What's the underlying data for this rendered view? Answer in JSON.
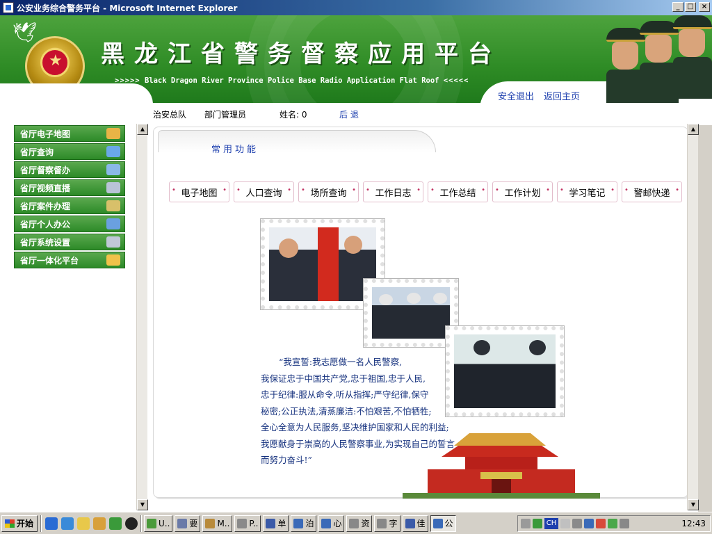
{
  "window": {
    "title": "公安业务综合警务平台 - Microsoft Internet Explorer",
    "buttons": {
      "minimize": "_",
      "maximize": "□",
      "close": "×"
    }
  },
  "header": {
    "title": "黑龙江省警务督察应用平台",
    "subtitle_arrows_left": ">>>>>",
    "subtitle": "Black Dragon River Province Police Base Radio Application Flat Roof",
    "subtitle_arrows_right": "<<<<<",
    "links": {
      "logout": "安全退出",
      "home": "返回主页"
    }
  },
  "info": {
    "unit": "治安总队",
    "role": "部门管理员",
    "name_label": "姓名: 0",
    "logout": "后 退"
  },
  "nav": {
    "items": [
      {
        "label": "省厅电子地图",
        "icon": "hand-map-icon",
        "color": "#e8b446"
      },
      {
        "label": "省厅查询",
        "icon": "magnifier-icon",
        "color": "#6aa8e8"
      },
      {
        "label": "省厅督察督办",
        "icon": "network-icon",
        "color": "#8ab8e8"
      },
      {
        "label": "省厅视频直播",
        "icon": "camera-icon",
        "color": "#b9c3d6"
      },
      {
        "label": "省厅案件办理",
        "icon": "pen-icon",
        "color": "#d8c06a"
      },
      {
        "label": "省厅个人办公",
        "icon": "person-icon",
        "color": "#6aa0e0"
      },
      {
        "label": "省厅系统设置",
        "icon": "settings-icon",
        "color": "#c0c8d8"
      },
      {
        "label": "省厅一体化平台",
        "icon": "grid-icon",
        "color": "#f0c24a"
      }
    ]
  },
  "main": {
    "tab_label": "常用功能",
    "functions": [
      "电子地图",
      "人口查询",
      "场所查询",
      "工作日志",
      "工作总结",
      "工作计划",
      "学习笔记",
      "警邮快递"
    ],
    "oath": [
      "“我宣誓:我志愿做一名人民警察,",
      "我保证忠于中国共产党,忠于祖国,忠于人民,",
      "忠于纪律:服从命令,听从指挥;严守纪律,保守",
      "秘密;公正执法,清蒸廉洁:不怕艰苦,不怕牺牲;",
      "全心全意为人民服务,坚决维护国家和人民的利益;",
      "我愿献身于崇高的人民警察事业,为实现自己的誓言",
      "而努力奋斗!”"
    ],
    "gate_banner": "天安门"
  },
  "taskbar": {
    "start": "开始",
    "tasks": [
      {
        "label": "U..",
        "color": "#4a9a3a"
      },
      {
        "label": "要",
        "color": "#6a7aa8"
      },
      {
        "label": "M..",
        "color": "#b88a3a"
      },
      {
        "label": "P..",
        "color": "#8a8a8a"
      },
      {
        "label": "单",
        "color": "#3a5aa8"
      },
      {
        "label": "泊",
        "color": "#3a6ab8"
      },
      {
        "label": "心",
        "color": "#3a6ab8"
      },
      {
        "label": "资",
        "color": "#888888"
      },
      {
        "label": "字",
        "color": "#888888"
      },
      {
        "label": "佳",
        "color": "#3a5aa8"
      },
      {
        "label": "公",
        "color": "#3a6ab8"
      }
    ],
    "tray_lang": "CH",
    "clock": "12:43"
  }
}
